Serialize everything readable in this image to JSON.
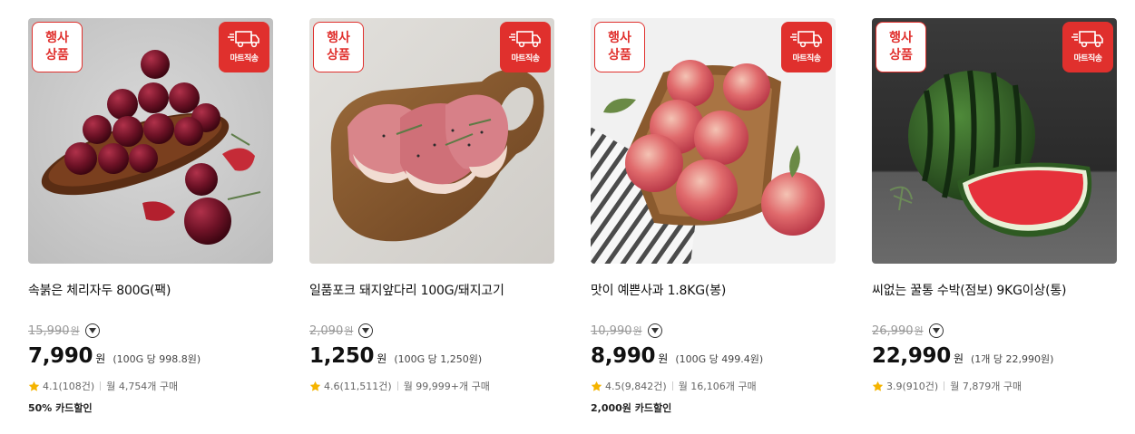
{
  "badges": {
    "event_line1": "행사",
    "event_line2": "상품",
    "delivery_label": "마트직송"
  },
  "products": [
    {
      "name": "속붉은 체리자두 800G(팩)",
      "original_price": "15,990",
      "currency": "원",
      "price": "7,990",
      "unit_price": "(100G 당 998.8원)",
      "rating": "4.1(108건)",
      "monthly_sales": "월 4,754개 구매",
      "discount": "50% 카드할인"
    },
    {
      "name": "일품포크 돼지앞다리 100G/돼지고기",
      "original_price": "2,090",
      "currency": "원",
      "price": "1,250",
      "unit_price": "(100G 당 1,250원)",
      "rating": "4.6(11,511건)",
      "monthly_sales": "월 99,999+개 구매",
      "discount": ""
    },
    {
      "name": "맛이 예쁜사과 1.8KG(봉)",
      "original_price": "10,990",
      "currency": "원",
      "price": "8,990",
      "unit_price": "(100G 당 499.4원)",
      "rating": "4.5(9,842건)",
      "monthly_sales": "월 16,106개 구매",
      "discount": "2,000원 카드할인"
    },
    {
      "name": "씨없는 꿀통 수박(점보) 9KG이상(통)",
      "original_price": "26,990",
      "currency": "원",
      "price": "22,990",
      "unit_price": "(1개 당 22,990원)",
      "rating": "3.9(910건)",
      "monthly_sales": "월 7,879개 구매",
      "discount": ""
    }
  ],
  "colors": {
    "accent": "#e0302d",
    "star": "#f5b400",
    "strike": "#999999"
  }
}
